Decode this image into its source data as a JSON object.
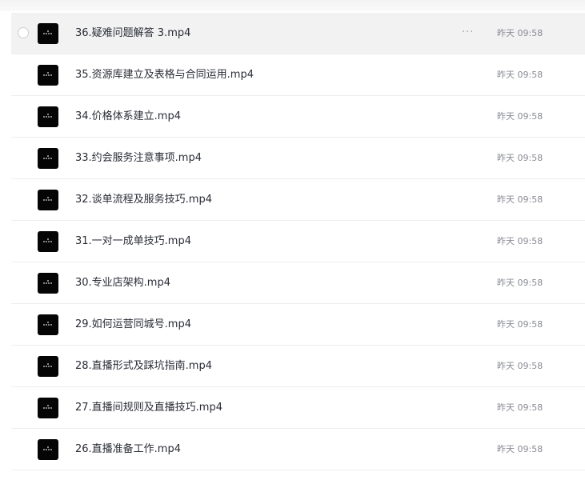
{
  "files": [
    {
      "name": "36.疑难问题解答 3.mp4",
      "time": "昨天 09:58"
    },
    {
      "name": "35.资源库建立及表格与合同运用.mp4",
      "time": "昨天 09:58"
    },
    {
      "name": "34.价格体系建立.mp4",
      "time": "昨天 09:58"
    },
    {
      "name": "33.约会服务注意事项.mp4",
      "time": "昨天 09:58"
    },
    {
      "name": "32.谈单流程及服务技巧.mp4",
      "time": "昨天 09:58"
    },
    {
      "name": "31.一对一成单技巧.mp4",
      "time": "昨天 09:58"
    },
    {
      "name": "30.专业店架构.mp4",
      "time": "昨天 09:58"
    },
    {
      "name": "29.如何运营同城号.mp4",
      "time": "昨天 09:58"
    },
    {
      "name": "28.直播形式及踩坑指南.mp4",
      "time": "昨天 09:58"
    },
    {
      "name": "27.直播间规则及直播技巧.mp4",
      "time": "昨天 09:58"
    },
    {
      "name": "26.直播准备工作.mp4",
      "time": "昨天 09:58"
    }
  ],
  "hover_row": {
    "more_icon": "more-dots-icon",
    "more_glyph": "···"
  },
  "thumbnail_icon": "video-thumbnail-icon"
}
